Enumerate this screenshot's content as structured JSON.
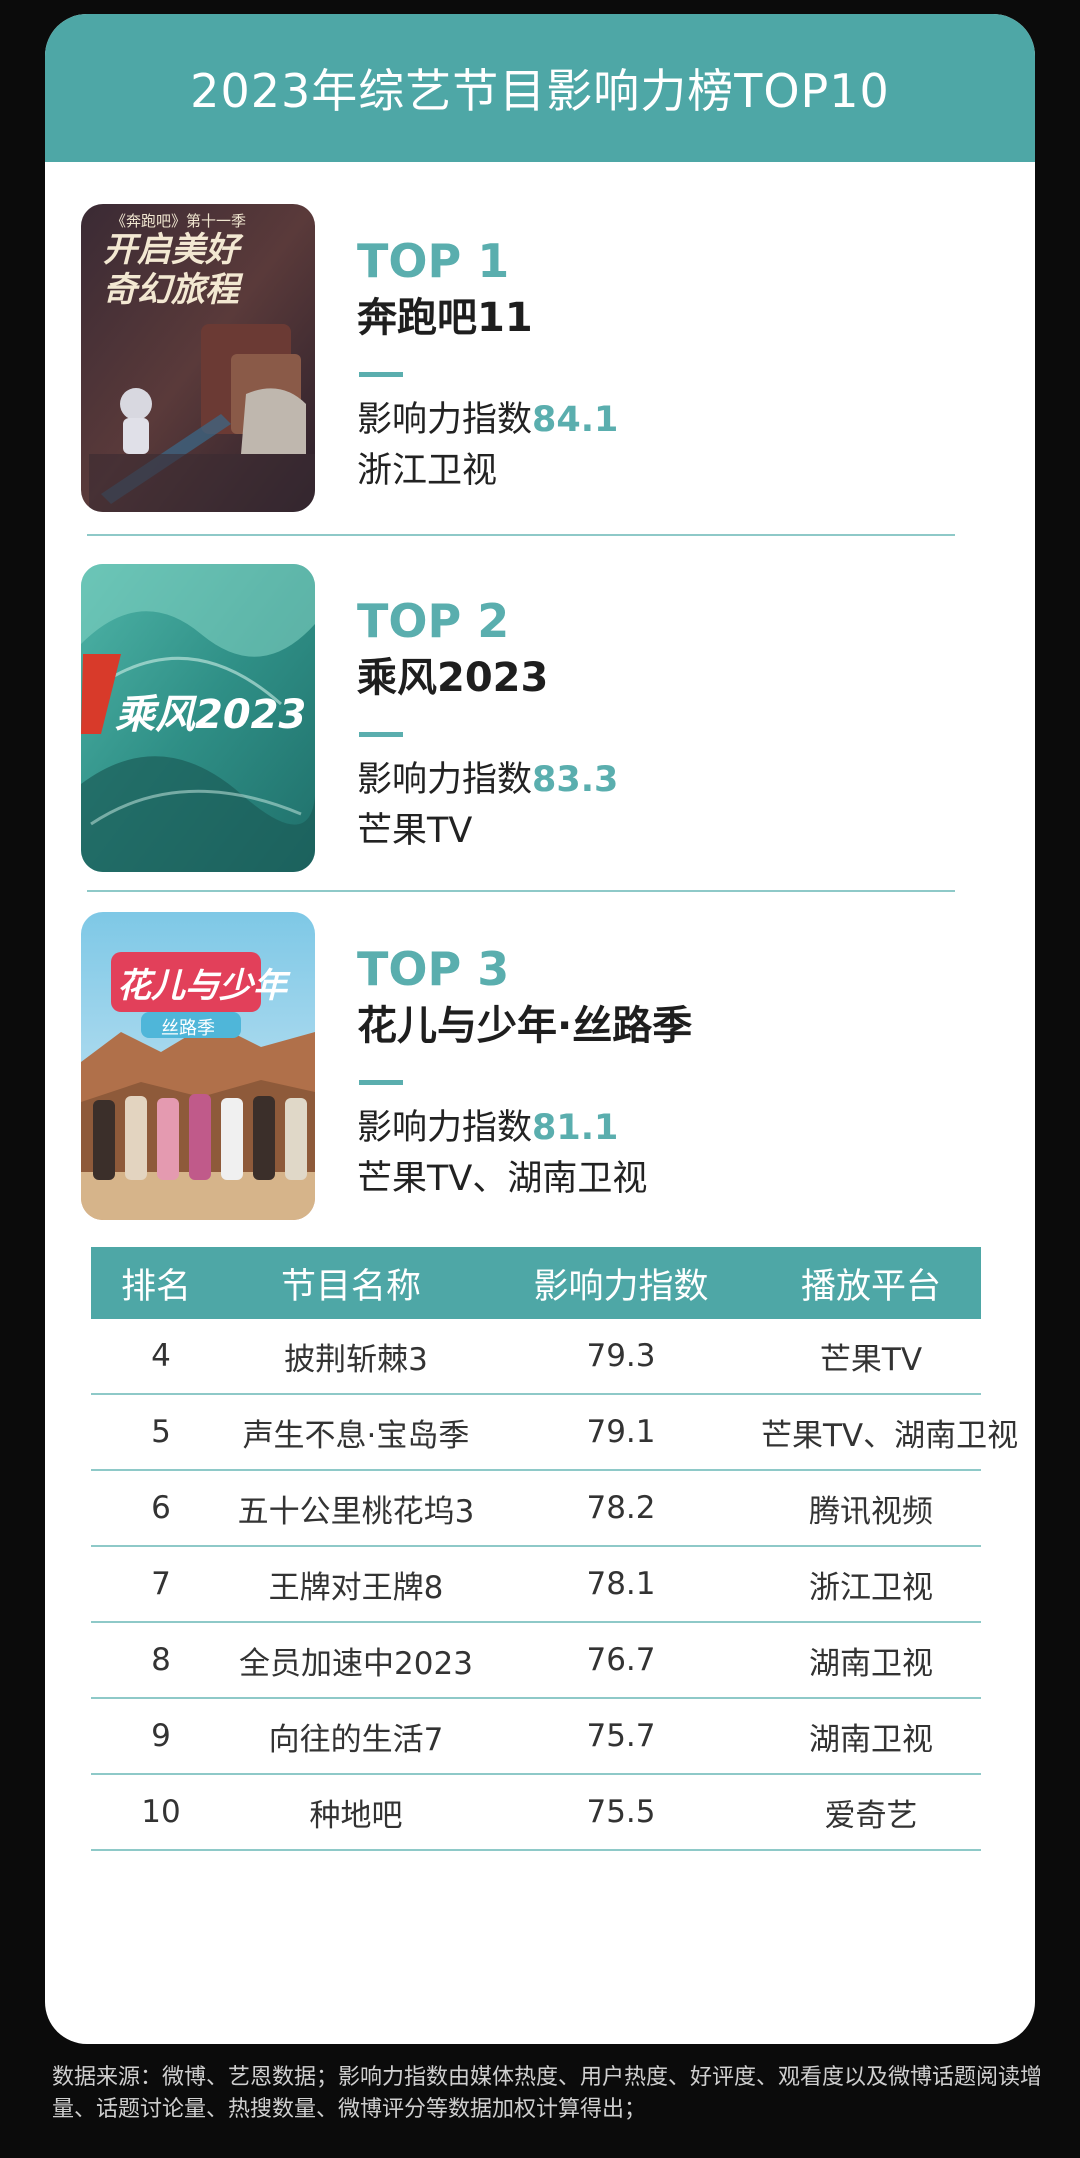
{
  "title": "2023年综艺节目影响力榜TOP10",
  "top": [
    {
      "rank": "TOP 1",
      "name": "奔跑吧11",
      "score_label": "影响力指数",
      "score": "84.1",
      "platform": "浙江卫视",
      "poster_text_top": "《奔跑吧》第十一季",
      "poster_text_main": "开启美好奇幻旅程"
    },
    {
      "rank": "TOP 2",
      "name": "乘风2023",
      "score_label": "影响力指数",
      "score": "83.3",
      "platform": "芒果TV",
      "poster_text_main": "乘风2023"
    },
    {
      "rank": "TOP 3",
      "name": "花儿与少年·丝路季",
      "score_label": "影响力指数",
      "score": "81.1",
      "platform": "芒果TV、湖南卫视",
      "poster_text_main": "花儿与少年",
      "poster_text_sub": "丝路季"
    }
  ],
  "table": {
    "headers": [
      "排名",
      "节目名称",
      "影响力指数",
      "播放平台"
    ],
    "rows": [
      [
        "4",
        "披荆斩棘3",
        "79.3",
        "芒果TV"
      ],
      [
        "5",
        "声生不息·宝岛季",
        "79.1",
        "芒果TV、湖南卫视"
      ],
      [
        "6",
        "五十公里桃花坞3",
        "78.2",
        "腾讯视频"
      ],
      [
        "7",
        "王牌对王牌8",
        "78.1",
        "浙江卫视"
      ],
      [
        "8",
        "全员加速中2023",
        "76.7",
        "湖南卫视"
      ],
      [
        "9",
        "向往的生活7",
        "75.7",
        "湖南卫视"
      ],
      [
        "10",
        "种地吧",
        "75.5",
        "爱奇艺"
      ]
    ]
  },
  "footer": "数据来源：微博、艺恩数据；影响力指数由媒体热度、用户热度、好评度、观看度以及微博话题阅读增量、话题讨论量、热搜数量、微博评分等数据加权计算得出；",
  "colors": {
    "accent": "#4ea7a6",
    "teal_text": "#5aaeae",
    "background": "#0b0b0b"
  }
}
